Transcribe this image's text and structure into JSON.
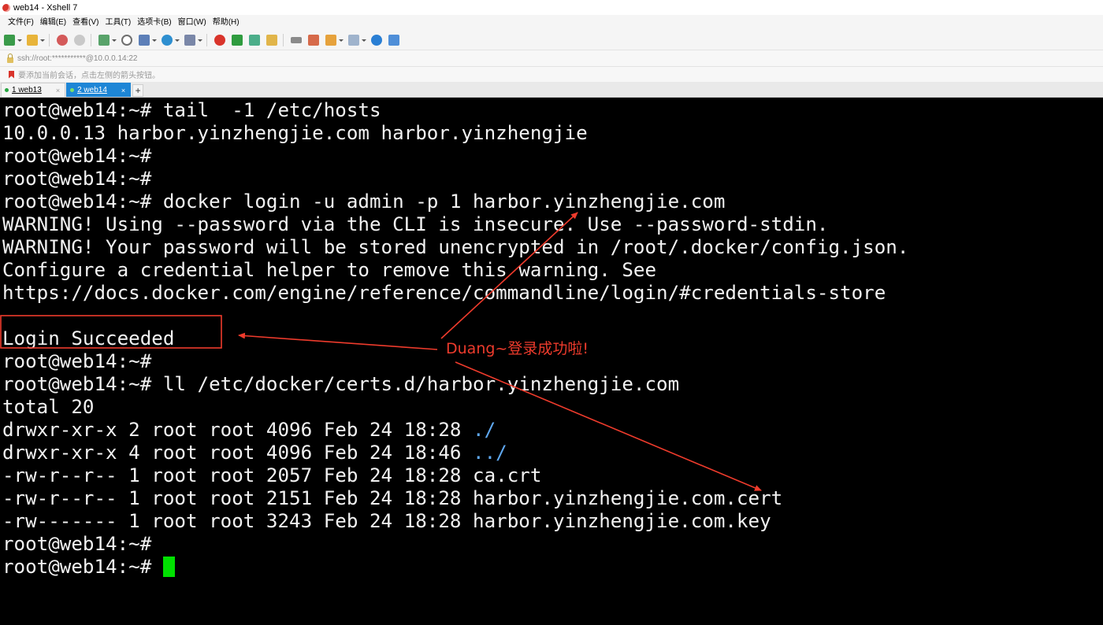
{
  "window": {
    "title": "web14 - Xshell 7"
  },
  "menu": [
    "文件(F)",
    "编辑(E)",
    "查看(V)",
    "工具(T)",
    "选项卡(B)",
    "窗口(W)",
    "帮助(H)"
  ],
  "toolbar_icons": [
    "new-session-icon",
    "open-folder-icon",
    "reconnect-icon",
    "disconnect-icon",
    "new-terminal-icon",
    "find-icon",
    "properties-icon",
    "globe-icon",
    "font-icon",
    "xshell-icon",
    "xftp-icon",
    "fullscreen-icon",
    "lock-icon",
    "keyboard-icon",
    "script-icon",
    "transfer-icon",
    "layout-icon",
    "help-icon",
    "chat-icon"
  ],
  "address": {
    "text": "ssh://root:***********@10.0.0.14:22"
  },
  "hint": {
    "text": "要添加当前会话，点击左侧的箭头按钮。"
  },
  "tabs": [
    {
      "label": "1 web13",
      "close": "×",
      "active": false
    },
    {
      "label": "2 web14",
      "close": "×",
      "active": true
    }
  ],
  "tab_add": "+",
  "terminal": {
    "lines": [
      "root@web14:~# tail  -1 /etc/hosts",
      "10.0.0.13 harbor.yinzhengjie.com harbor.yinzhengjie",
      "root@web14:~#",
      "root@web14:~#",
      "root@web14:~# docker login -u admin -p 1 harbor.yinzhengjie.com",
      "WARNING! Using --password via the CLI is insecure. Use --password-stdin.",
      "WARNING! Your password will be stored unencrypted in /root/.docker/config.json.",
      "Configure a credential helper to remove this warning. See",
      "https://docs.docker.com/engine/reference/commandline/login/#credentials-store",
      "",
      "Login Succeeded",
      "root@web14:~#",
      "root@web14:~# ll /etc/docker/certs.d/harbor.yinzhengjie.com",
      "total 20",
      {
        "prefix": "drwxr-xr-x 2 root root 4096 Feb 24 18:28 ",
        "dir": "./"
      },
      {
        "prefix": "drwxr-xr-x 4 root root 4096 Feb 24 18:46 ",
        "dir": "../"
      },
      "-rw-r--r-- 1 root root 2057 Feb 24 18:28 ca.crt",
      "-rw-r--r-- 1 root root 2151 Feb 24 18:28 harbor.yinzhengjie.com.cert",
      "-rw------- 1 root root 3243 Feb 24 18:28 harbor.yinzhengjie.com.key",
      "root@web14:~#",
      {
        "prefix": "root@web14:~# ",
        "cursor": true
      }
    ]
  },
  "annotation": {
    "text": "Duang~登录成功啦!",
    "color": "#ee3b2c"
  },
  "colors": {
    "terminal_bg": "#000000",
    "terminal_fg": "#f2f2f2",
    "dir": "#5fa8f0",
    "cursor": "#00e000",
    "tab_active": "#1e86d6"
  }
}
